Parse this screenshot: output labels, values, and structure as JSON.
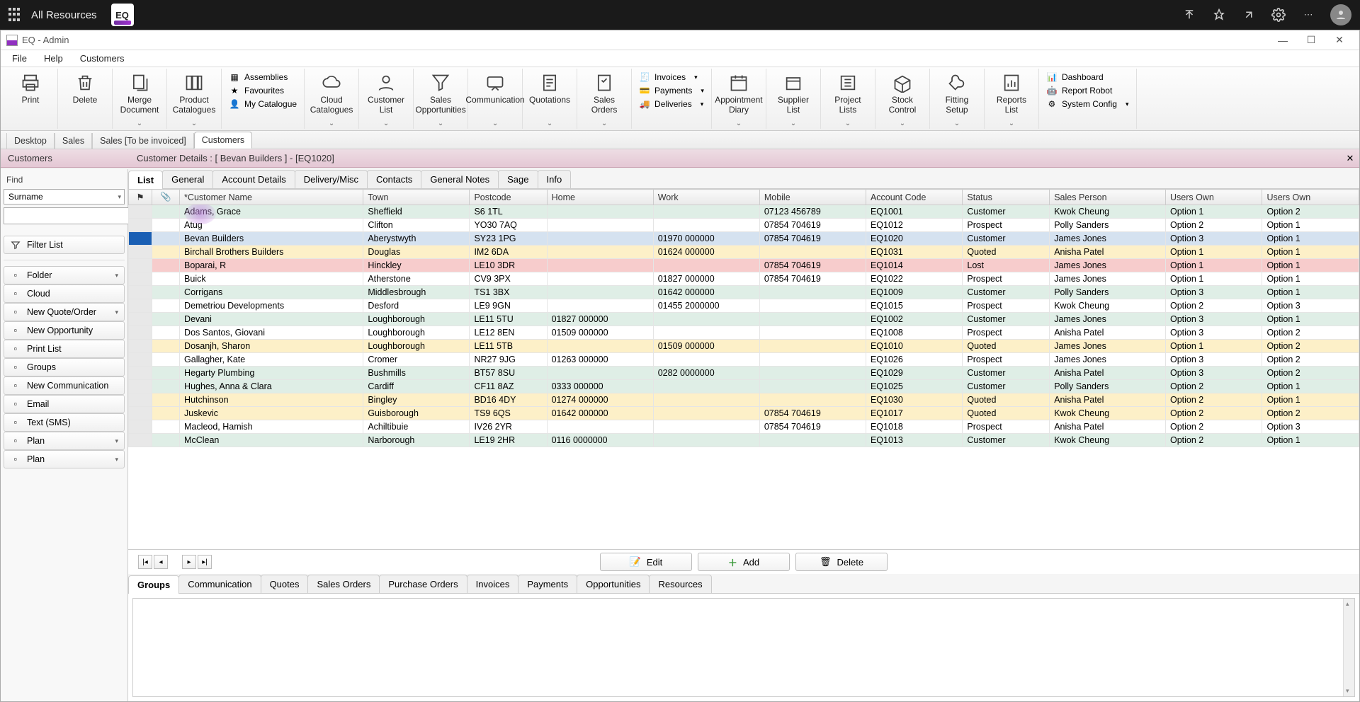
{
  "topbar": {
    "title": "All Resources"
  },
  "window": {
    "title": "EQ - Admin"
  },
  "menu": [
    "File",
    "Help",
    "Customers"
  ],
  "ribbon": {
    "big": [
      {
        "label": "Print"
      },
      {
        "label": "Delete"
      },
      {
        "label": "Merge Document"
      },
      {
        "label": "Product Catalogues"
      }
    ],
    "smallset1": [
      "Assemblies",
      "Favourites",
      "My Catalogue"
    ],
    "big2": [
      {
        "label": "Cloud Catalogues"
      },
      {
        "label": "Customer List"
      },
      {
        "label": "Sales Opportunities"
      },
      {
        "label": "Communication"
      },
      {
        "label": "Quotations"
      },
      {
        "label": "Sales Orders"
      }
    ],
    "smallset2": [
      "Invoices",
      "Payments",
      "Deliveries"
    ],
    "big3": [
      {
        "label": "Appointment Diary"
      },
      {
        "label": "Supplier List"
      },
      {
        "label": "Project Lists"
      },
      {
        "label": "Stock Control"
      },
      {
        "label": "Fitting Setup"
      },
      {
        "label": "Reports List"
      }
    ],
    "smallset3": [
      "Dashboard",
      "Report Robot",
      "System Config"
    ]
  },
  "wintabs": [
    "Desktop",
    "Sales",
    "Sales [To be invoiced]",
    "Customers"
  ],
  "wintab_active": 3,
  "headleft": "Customers",
  "headright": "Customer Details : [ Bevan Builders ]  -  [EQ1020]",
  "sidebar": {
    "find_label": "Find",
    "surname": "Surname",
    "filter": "Filter List",
    "items": [
      {
        "label": "Folder",
        "drop": true,
        "icon": "folder"
      },
      {
        "label": "Cloud",
        "drop": false,
        "icon": "cloud"
      },
      {
        "label": "New Quote/Order",
        "drop": true,
        "icon": "doc"
      },
      {
        "label": "New Opportunity",
        "drop": false,
        "icon": "doc"
      },
      {
        "label": "Print List",
        "drop": false,
        "icon": "print"
      },
      {
        "label": "Groups",
        "drop": false,
        "icon": "group"
      },
      {
        "label": "New Communication",
        "drop": false,
        "icon": "chat"
      },
      {
        "label": "Email",
        "drop": false,
        "icon": "mail"
      },
      {
        "label": "Text (SMS)",
        "drop": false,
        "icon": "phone"
      },
      {
        "label": "Plan",
        "drop": true,
        "icon": "plan"
      },
      {
        "label": "Plan",
        "drop": true,
        "icon": "plan"
      }
    ]
  },
  "dtabs": [
    "List",
    "General",
    "Account Details",
    "Delivery/Misc",
    "Contacts",
    "General Notes",
    "Sage",
    "Info"
  ],
  "dtab_active": 0,
  "columns": [
    "",
    "",
    "  *Customer Name",
    "Town",
    "Postcode",
    "Home",
    "Work",
    "Mobile",
    "Account Code",
    "Status",
    "Sales Person",
    "Users Own",
    "Users Own"
  ],
  "rows": [
    {
      "c": "mint",
      "d": [
        "",
        "",
        "Adams, Grace",
        "Sheffield",
        "S6 1TL",
        "",
        "",
        "07123 456789",
        "EQ1001",
        "Customer",
        "Kwok Cheung",
        "Option 1",
        "Option 2"
      ]
    },
    {
      "c": "white",
      "d": [
        "",
        "",
        "Atug",
        "Clifton",
        "YO30 7AQ",
        "",
        "",
        "07854 704619",
        "EQ1012",
        "Prospect",
        "Polly Sanders",
        "Option 2",
        "Option 1"
      ]
    },
    {
      "c": "sel",
      "d": [
        "",
        "",
        "Bevan Builders",
        "Aberystwyth",
        "SY23 1PG",
        "",
        "01970 000000",
        "07854 704619",
        "EQ1020",
        "Customer",
        "James Jones",
        "Option 3",
        "Option 1"
      ]
    },
    {
      "c": "yellow",
      "d": [
        "",
        "",
        "Birchall Brothers Builders",
        "Douglas",
        "IM2 6DA",
        "",
        "01624 000000",
        "",
        "EQ1031",
        "Quoted",
        "Anisha Patel",
        "Option 1",
        "Option 1"
      ]
    },
    {
      "c": "pink",
      "d": [
        "",
        "",
        "Boparai, R",
        "Hinckley",
        "LE10 3DR",
        "",
        "",
        "07854 704619",
        "EQ1014",
        "Lost",
        "James Jones",
        "Option 1",
        "Option 1"
      ]
    },
    {
      "c": "white",
      "d": [
        "",
        "",
        "Buick",
        "Atherstone",
        "CV9 3PX",
        "",
        "01827 000000",
        "07854 704619",
        "EQ1022",
        "Prospect",
        "James Jones",
        "Option 1",
        "Option 1"
      ]
    },
    {
      "c": "mint",
      "d": [
        "",
        "",
        "Corrigans",
        "Middlesbrough",
        "TS1 3BX",
        "",
        "01642 000000",
        "",
        "EQ1009",
        "Customer",
        "Polly Sanders",
        "Option 3",
        "Option 1"
      ]
    },
    {
      "c": "white",
      "d": [
        "",
        "",
        "Demetriou Developments",
        "Desford",
        "LE9 9GN",
        "",
        "01455 2000000",
        "",
        "EQ1015",
        "Prospect",
        "Kwok Cheung",
        "Option 2",
        "Option 3"
      ]
    },
    {
      "c": "mint",
      "d": [
        "",
        "",
        "Devani",
        "Loughborough",
        "LE11 5TU",
        "01827 000000",
        "",
        "",
        "EQ1002",
        "Customer",
        "James Jones",
        "Option 3",
        "Option 1"
      ]
    },
    {
      "c": "white",
      "d": [
        "",
        "",
        "Dos Santos, Giovani",
        "Loughborough",
        "LE12 8EN",
        "01509 000000",
        "",
        "",
        "EQ1008",
        "Prospect",
        "Anisha Patel",
        "Option 3",
        "Option 2"
      ]
    },
    {
      "c": "yellow",
      "d": [
        "",
        "",
        "Dosanjh, Sharon",
        "Loughborough",
        "LE11 5TB",
        "",
        "01509 000000",
        "",
        "EQ1010",
        "Quoted",
        "James Jones",
        "Option 1",
        "Option 2"
      ]
    },
    {
      "c": "white",
      "d": [
        "",
        "",
        "Gallagher, Kate",
        "Cromer",
        "NR27 9JG",
        "01263 000000",
        "",
        "",
        "EQ1026",
        "Prospect",
        "James Jones",
        "Option 3",
        "Option 2"
      ]
    },
    {
      "c": "mint",
      "d": [
        "",
        "",
        "Hegarty Plumbing",
        "Bushmills",
        "BT57 8SU",
        "",
        "0282 0000000",
        "",
        "EQ1029",
        "Customer",
        "Anisha Patel",
        "Option 3",
        "Option 2"
      ]
    },
    {
      "c": "mint",
      "d": [
        "",
        "",
        "Hughes, Anna & Clara",
        "Cardiff",
        "CF11 8AZ",
        "0333 000000",
        "",
        "",
        "EQ1025",
        "Customer",
        "Polly Sanders",
        "Option 2",
        "Option 1"
      ]
    },
    {
      "c": "yellow",
      "d": [
        "",
        "",
        "Hutchinson",
        "Bingley",
        "BD16 4DY",
        "01274 000000",
        "",
        "",
        "EQ1030",
        "Quoted",
        "Anisha Patel",
        "Option 2",
        "Option 1"
      ]
    },
    {
      "c": "yellow",
      "d": [
        "",
        "",
        "Juskevic",
        "Guisborough",
        "TS9 6QS",
        "01642 000000",
        "",
        "07854 704619",
        "EQ1017",
        "Quoted",
        "Kwok Cheung",
        "Option 2",
        "Option 2"
      ]
    },
    {
      "c": "white",
      "d": [
        "",
        "",
        "Macleod, Hamish",
        "Achiltibuie",
        "IV26 2YR",
        "",
        "",
        "07854 704619",
        "EQ1018",
        "Prospect",
        "Anisha Patel",
        "Option 2",
        "Option 3"
      ]
    },
    {
      "c": "mint",
      "d": [
        "",
        "",
        "McClean",
        "Narborough",
        "LE19 2HR",
        "0116 0000000",
        "",
        "",
        "EQ1013",
        "Customer",
        "Kwok Cheung",
        "Option 2",
        "Option 1"
      ]
    }
  ],
  "actions": {
    "edit": "Edit",
    "add": "Add",
    "delete": "Delete"
  },
  "btabs": [
    "Groups",
    "Communication",
    "Quotes",
    "Sales Orders",
    "Purchase Orders",
    "Invoices",
    "Payments",
    "Opportunities",
    "Resources"
  ],
  "btab_active": 0
}
